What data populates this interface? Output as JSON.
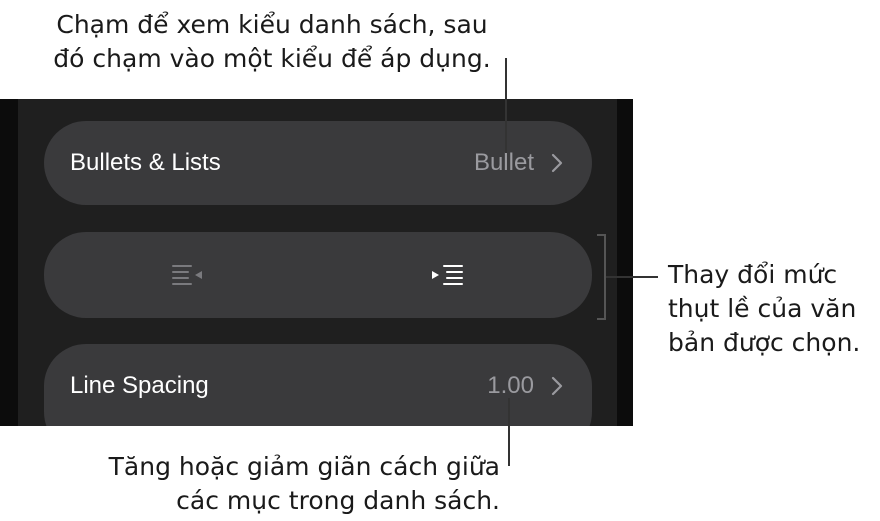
{
  "callouts": {
    "top": [
      "Chạm để xem kiểu danh sách, sau",
      "đó chạm vào một kiểu để áp dụng."
    ],
    "right": [
      "Thay đổi mức",
      "thụt lề của văn",
      "bản được chọn."
    ],
    "bottom": [
      "Tăng hoặc giảm giãn cách giữa",
      "các mục trong danh sách."
    ]
  },
  "panel": {
    "bullets_lists": {
      "label": "Bullets & Lists",
      "value": "Bullet",
      "icon": "chevron-right-icon"
    },
    "indent_controls": {
      "outdent_icon": "decrease-indent-icon",
      "indent_icon": "increase-indent-icon",
      "outdent_enabled": false,
      "indent_enabled": true
    },
    "line_spacing": {
      "label": "Line Spacing",
      "value": "1.00",
      "icon": "chevron-right-icon"
    }
  },
  "colors": {
    "panel_bg": "#1f1f1f",
    "row_bg": "#3a3a3c",
    "value_text": "#9a9a9f",
    "disabled_icon": "#7a7a7e"
  }
}
